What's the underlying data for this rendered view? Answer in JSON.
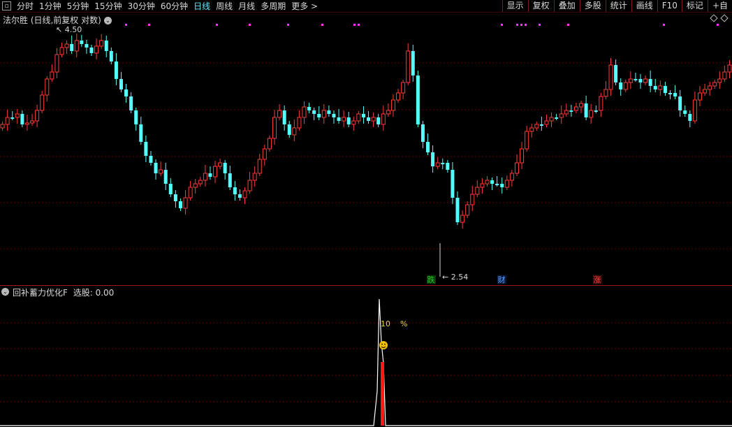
{
  "toolbar": {
    "square_icon": "square-icon",
    "periods": [
      {
        "label": "分时",
        "active": false
      },
      {
        "label": "1分钟",
        "active": false
      },
      {
        "label": "5分钟",
        "active": false
      },
      {
        "label": "15分钟",
        "active": false
      },
      {
        "label": "30分钟",
        "active": false
      },
      {
        "label": "60分钟",
        "active": false
      },
      {
        "label": "日线",
        "active": true
      },
      {
        "label": "周线",
        "active": false
      },
      {
        "label": "月线",
        "active": false
      },
      {
        "label": "多周期",
        "active": false
      },
      {
        "label": "更多 >",
        "active": false
      }
    ],
    "right_buttons": [
      "显示",
      "复权",
      "叠加",
      "多股",
      "统计",
      "画线",
      "F10",
      "标记",
      "+自"
    ]
  },
  "main_panel": {
    "title": "法尔胜 (日线,前复权 对数)",
    "high_label": "4.50",
    "low_label": "2.54",
    "signals": [
      {
        "text": "跌",
        "color": "#22c722",
        "bg": "#0a3a0a"
      },
      {
        "text": "财",
        "color": "#5aa0ff",
        "bg": "#0a1a3a"
      },
      {
        "text": "涨",
        "color": "#ff4040",
        "bg": "#3a0a0a"
      }
    ]
  },
  "sub_panel": {
    "title": "回补蓄力优化F",
    "value_label": "选股: 0.00",
    "peak_label": "10",
    "percent_label": "%"
  },
  "colors": {
    "up": "#ff3b3b",
    "down": "#54ffff",
    "grid": "#6b0000",
    "marker": "#ff33ff",
    "divider": "#a11818"
  }
}
